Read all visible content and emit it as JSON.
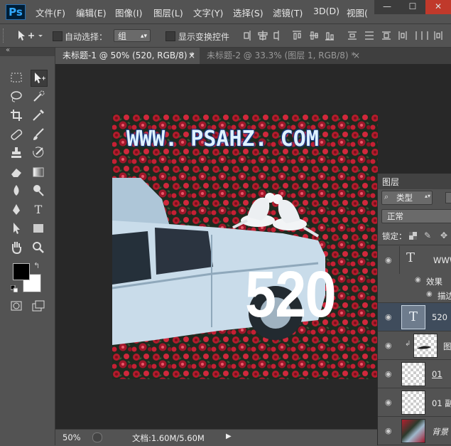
{
  "app": {
    "logo": "Ps"
  },
  "menu": [
    "文件(F)",
    "编辑(E)",
    "图像(I)",
    "图层(L)",
    "文字(Y)",
    "选择(S)",
    "滤镜(T)",
    "3D(D)",
    "视图("
  ],
  "window_controls": {
    "minimize": "—",
    "restore": "☐",
    "close": "✕"
  },
  "options_bar": {
    "auto_select_label": "自动选择：",
    "auto_select_value": "组",
    "show_transform_label": "显示变换控件"
  },
  "tabs": [
    {
      "label": "未标题-1 @ 50% (520, RGB/8) *",
      "close": "×"
    },
    {
      "label": "未标题-2 @ 33.3% (图层 1, RGB/8) *",
      "close": "×"
    }
  ],
  "canvas": {
    "url_text": "WWW. PSAHZ. COM",
    "number_text": "520"
  },
  "status": {
    "zoom": "50%",
    "doc": "文档:1.60M/5.60M"
  },
  "layers_panel": {
    "title": "图层",
    "kind_filter": "类型",
    "blend_mode": "正常",
    "lock_label": "锁定：",
    "layers": [
      {
        "name": "WWW",
        "type": "text"
      },
      {
        "name": "效果",
        "type": "effect"
      },
      {
        "name": "描边",
        "type": "effect"
      },
      {
        "name": "520",
        "type": "text"
      },
      {
        "name": "图",
        "type": "clipped"
      },
      {
        "name": "01",
        "type": "pixel"
      },
      {
        "name": "01 副",
        "type": "pixel"
      },
      {
        "name": "背景",
        "type": "background"
      }
    ]
  },
  "colors": {
    "foreground": "#000000",
    "background": "#ffffff",
    "accent": "#31a8ff"
  }
}
